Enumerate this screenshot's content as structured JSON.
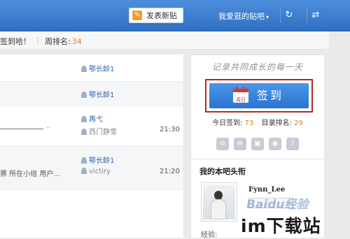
{
  "topbar": {
    "post_button": "发表新贴",
    "post_icon": "edit-icon",
    "fav_menu": "我爱逛的贴吧",
    "fav_caret": "▾",
    "refresh_icon": "↻",
    "swap_icon": "⇄",
    "colors": {
      "bar": "#3b7dd0",
      "post_icon_bg": "#f29b2d"
    }
  },
  "strip": {
    "sign_text": "签到哈！",
    "week_rank_label": "周排名:",
    "week_rank_value": "34",
    "separator": "|"
  },
  "threads": [
    {
      "user": "鄂长龄1",
      "user_style": "blue",
      "time": "",
      "excerpt": ""
    },
    {
      "user": "鄂长龄1",
      "user_style": "blue",
      "time": "",
      "excerpt": ""
    },
    {
      "user": "再弋",
      "user_style": "blue",
      "last_user": "西门静雪",
      "time": "21:30",
      "excerpt": "——————————————"
    },
    {
      "user": "鄂长龄1",
      "user_style": "blue",
      "last_user": "victiry",
      "time": "21:20",
      "excerpt": "票 所在小组 用户..."
    }
  ],
  "sidebar": {
    "slogan": "记录共同成长的每一天",
    "sign_button": "签到",
    "calendar_label": "周日",
    "today_sign_label": "今日签到:",
    "today_sign_value": "73",
    "catalog_rank_label": "目录排名:",
    "catalog_rank_value": "29",
    "badges": [
      "⊘",
      "⊛",
      "▣",
      "◉",
      "⇧"
    ],
    "head_title": "我的本吧头衔",
    "username": "Fynn_Lee",
    "exp_label": "经验:"
  },
  "watermarks": {
    "baidu": "Baidu经验",
    "site": "im下载站"
  }
}
